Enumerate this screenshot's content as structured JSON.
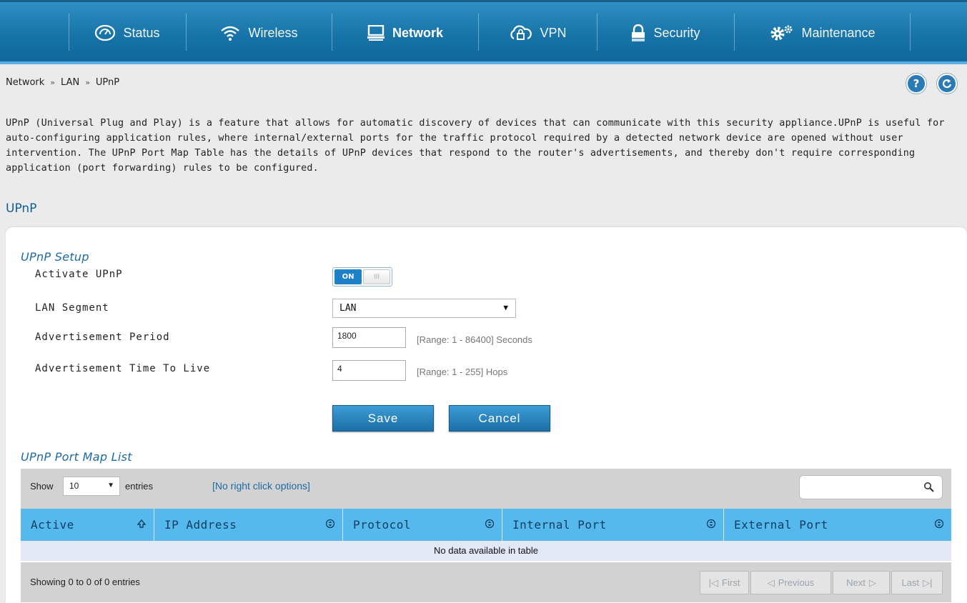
{
  "nav": {
    "items": [
      {
        "label": "Status",
        "icon": "speedometer-icon"
      },
      {
        "label": "Wireless",
        "icon": "wifi-icon"
      },
      {
        "label": "Network",
        "icon": "monitor-icon",
        "active": true
      },
      {
        "label": "VPN",
        "icon": "cloud-lock-icon"
      },
      {
        "label": "Security",
        "icon": "lock-icon"
      },
      {
        "label": "Maintenance",
        "icon": "gears-icon"
      }
    ]
  },
  "breadcrumb": {
    "items": [
      "Network",
      "LAN",
      "UPnP"
    ],
    "separator": "»"
  },
  "help_icon": "?",
  "description": "UPnP (Universal Plug and Play) is a feature that allows for automatic discovery of devices that can communicate with this security appliance.UPnP is useful for auto-configuring application rules, where internal/external ports for the traffic protocol required by a detected network device are opened without user intervention. The UPnP Port Map Table has the details of UPnP devices that respond to the router's advertisements, and thereby don't require corresponding application (port forwarding) rules to be configured.",
  "section_title": "UPnP",
  "setup": {
    "title": "UPnP Setup",
    "activate_label": "Activate UPnP",
    "toggle_on_text": "ON",
    "toggle_knob_text": "III",
    "lan_segment_label": "LAN Segment",
    "lan_segment_value": "LAN",
    "adv_period_label": "Advertisement Period",
    "adv_period_value": "1800",
    "adv_period_range": "[Range: 1 - 86400] Seconds",
    "adv_ttl_label": "Advertisement Time To Live",
    "adv_ttl_value": "4",
    "adv_ttl_range": "[Range: 1 - 255] Hops",
    "save_label": "Save",
    "cancel_label": "Cancel"
  },
  "portmap": {
    "title": "UPnP Port Map List",
    "show_label": "Show",
    "show_value": "10",
    "entries_label": "entries",
    "no_right_click": "[No right click options]",
    "search_value": "",
    "columns": [
      "Active",
      "IP Address",
      "Protocol",
      "Internal Port",
      "External Port"
    ],
    "empty_message": "No data available in table",
    "showing_text": "Showing 0 to 0 of 0 entries",
    "pager": {
      "first": "First",
      "previous": "Previous",
      "next": "Next",
      "last": "Last"
    }
  },
  "colors": {
    "nav_bg": "#1773a8",
    "accent": "#1c6aa3",
    "table_header": "#56b9ee",
    "button": "#2580bd"
  }
}
